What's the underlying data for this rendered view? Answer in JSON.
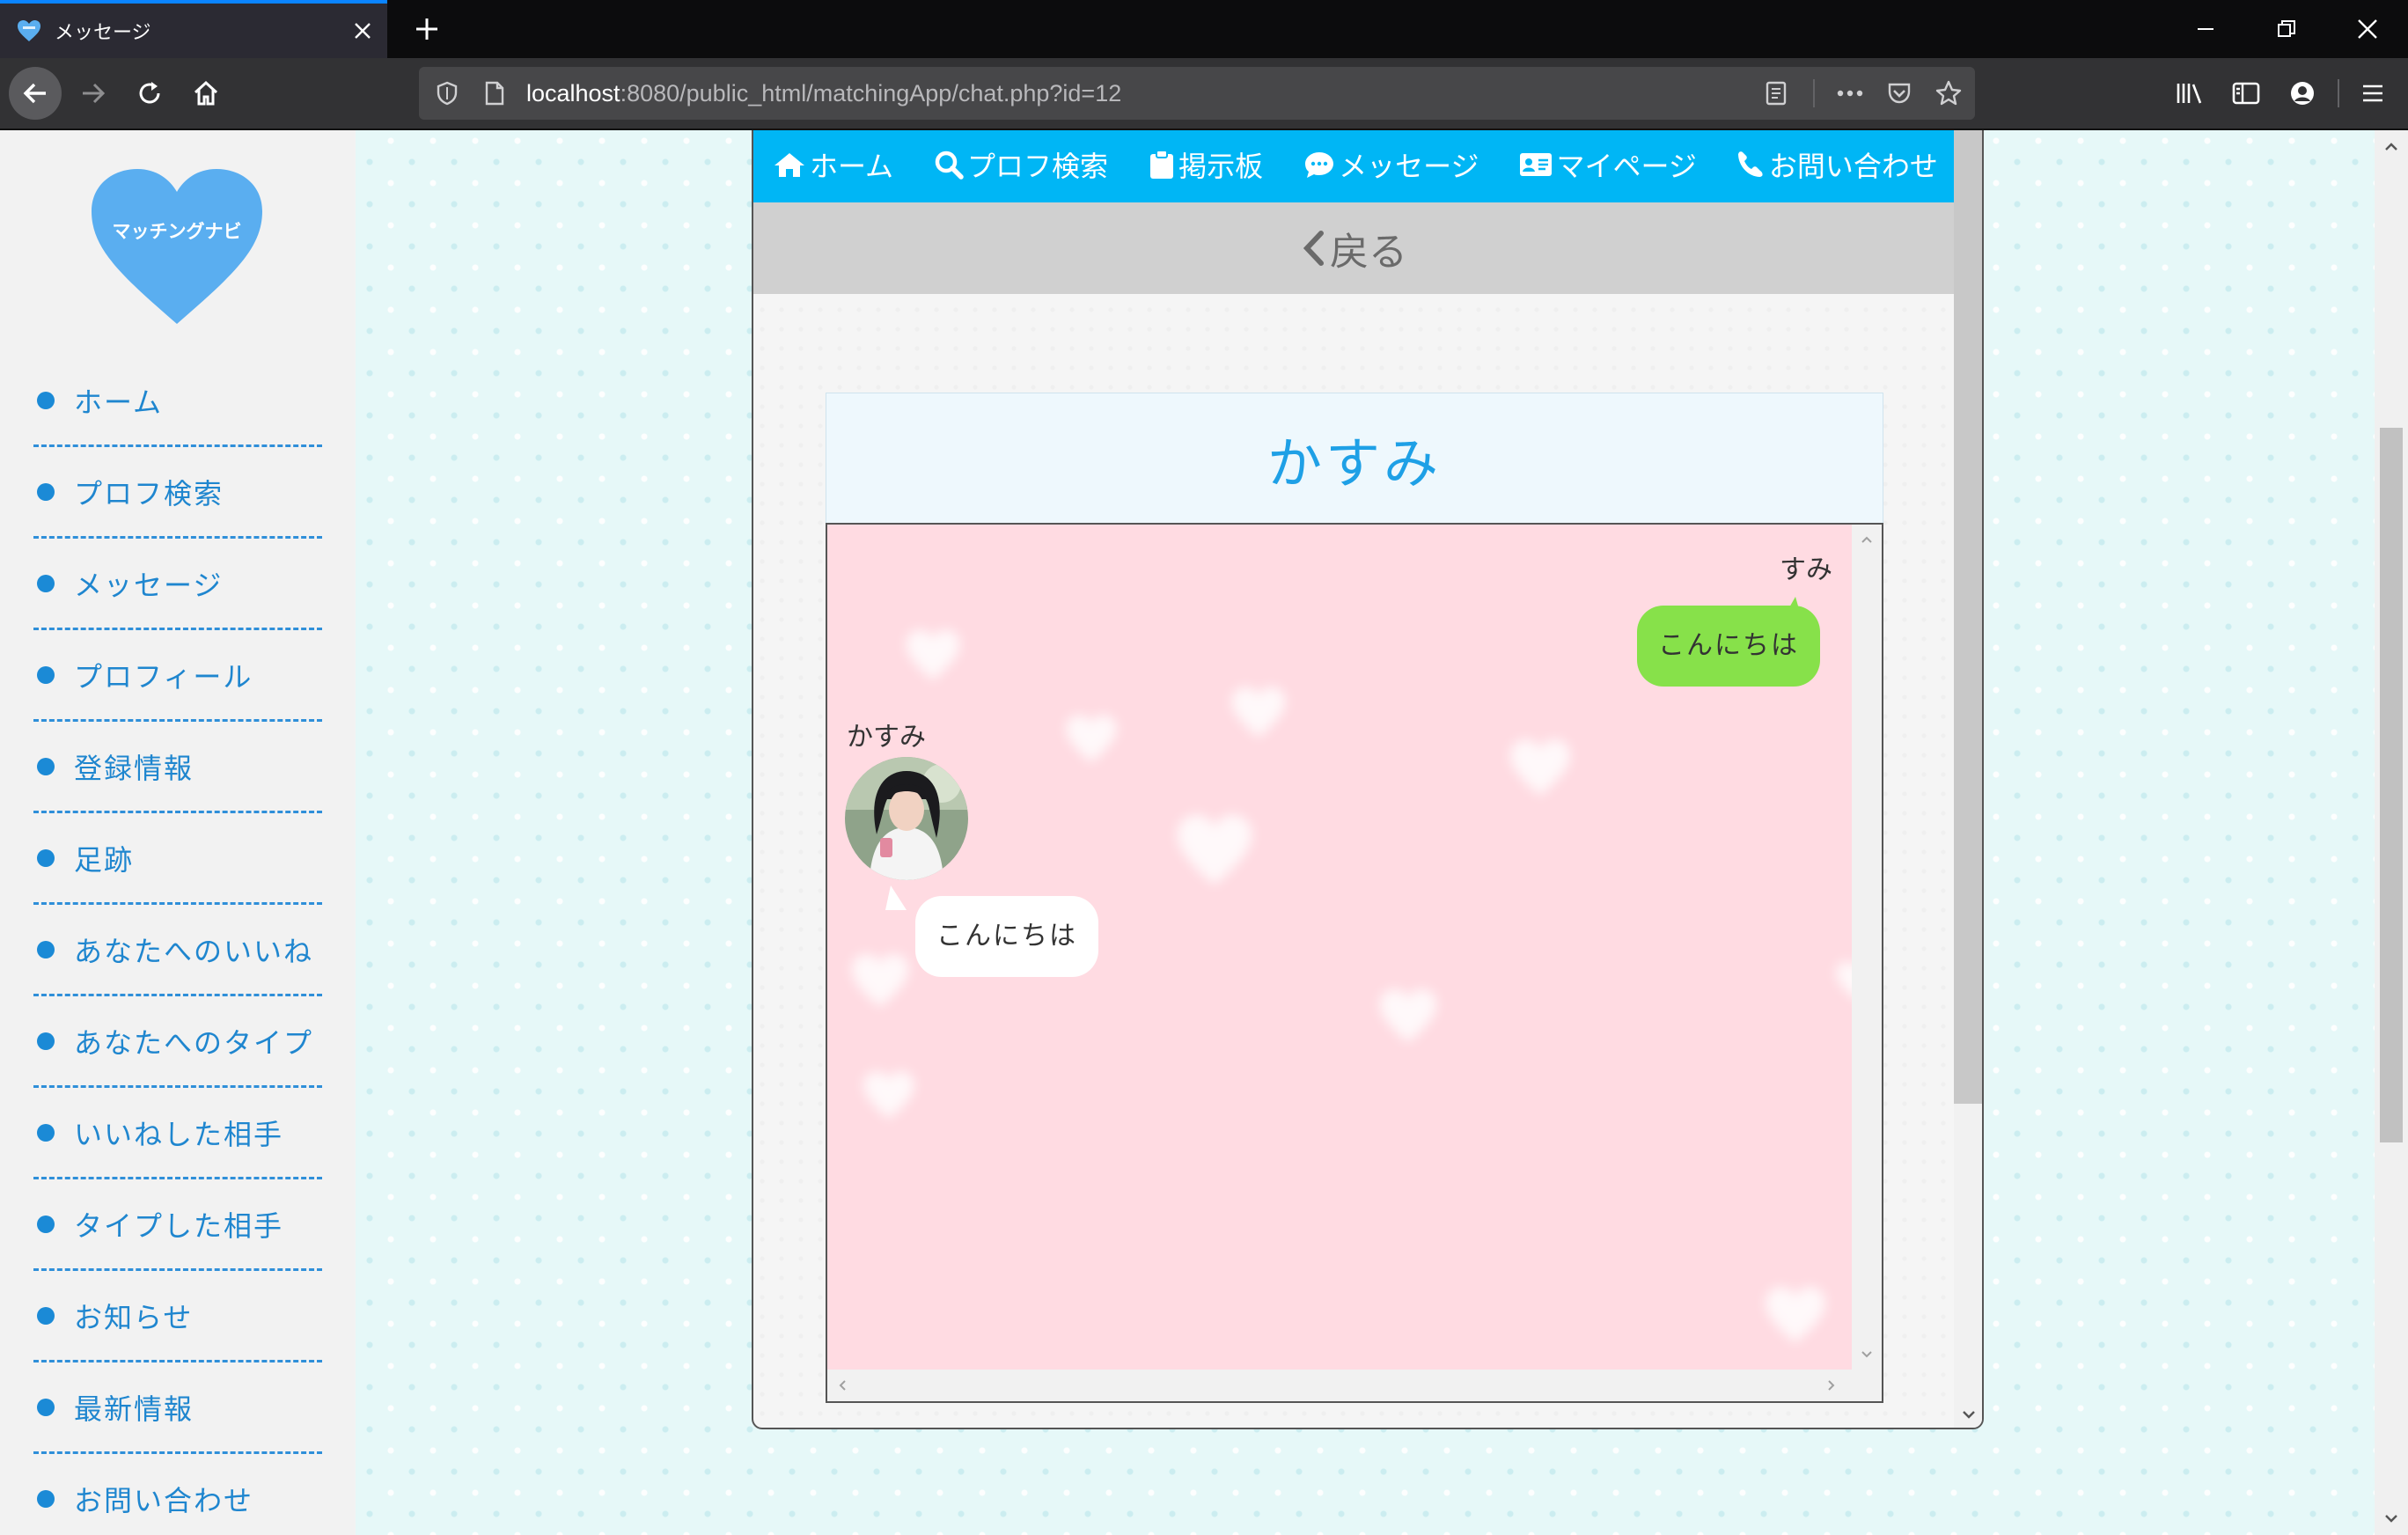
{
  "browser": {
    "tab_title": "メッセージ",
    "url_host": "localhost",
    "url_rest": ":8080/public_html/matchingApp/chat.php?id=12"
  },
  "logo": {
    "text": "マッチングナビ",
    "color": "#5aaef0"
  },
  "sidebar": {
    "items": [
      {
        "label": "ホーム"
      },
      {
        "label": "プロフ検索"
      },
      {
        "label": "メッセージ"
      },
      {
        "label": "プロフィール"
      },
      {
        "label": "登録情報"
      },
      {
        "label": "足跡"
      },
      {
        "label": "あなたへのいいね"
      },
      {
        "label": "あなたへのタイプ"
      },
      {
        "label": "いいねした相手"
      },
      {
        "label": "タイプした相手"
      },
      {
        "label": "お知らせ"
      },
      {
        "label": "最新情報"
      },
      {
        "label": "お問い合わせ"
      }
    ]
  },
  "topnav": {
    "items": [
      {
        "label": "ホーム",
        "icon": "home-icon"
      },
      {
        "label": "プロフ検索",
        "icon": "search-icon"
      },
      {
        "label": "掲示板",
        "icon": "clipboard-icon"
      },
      {
        "label": "メッセージ",
        "icon": "comment-icon"
      },
      {
        "label": "マイページ",
        "icon": "id-card-icon"
      },
      {
        "label": "お問い合わせ",
        "icon": "phone-icon"
      }
    ],
    "color": "#00b6f5"
  },
  "back": {
    "label": "戻る"
  },
  "chat": {
    "partner_name": "かすみ",
    "messages": [
      {
        "sender": "すみ",
        "text": "こんにちは",
        "side": "right",
        "color": "#87e14a"
      },
      {
        "sender": "かすみ",
        "text": "こんにちは",
        "side": "left",
        "color": "#ffffff"
      }
    ],
    "background_color": "#ffdbe2"
  }
}
